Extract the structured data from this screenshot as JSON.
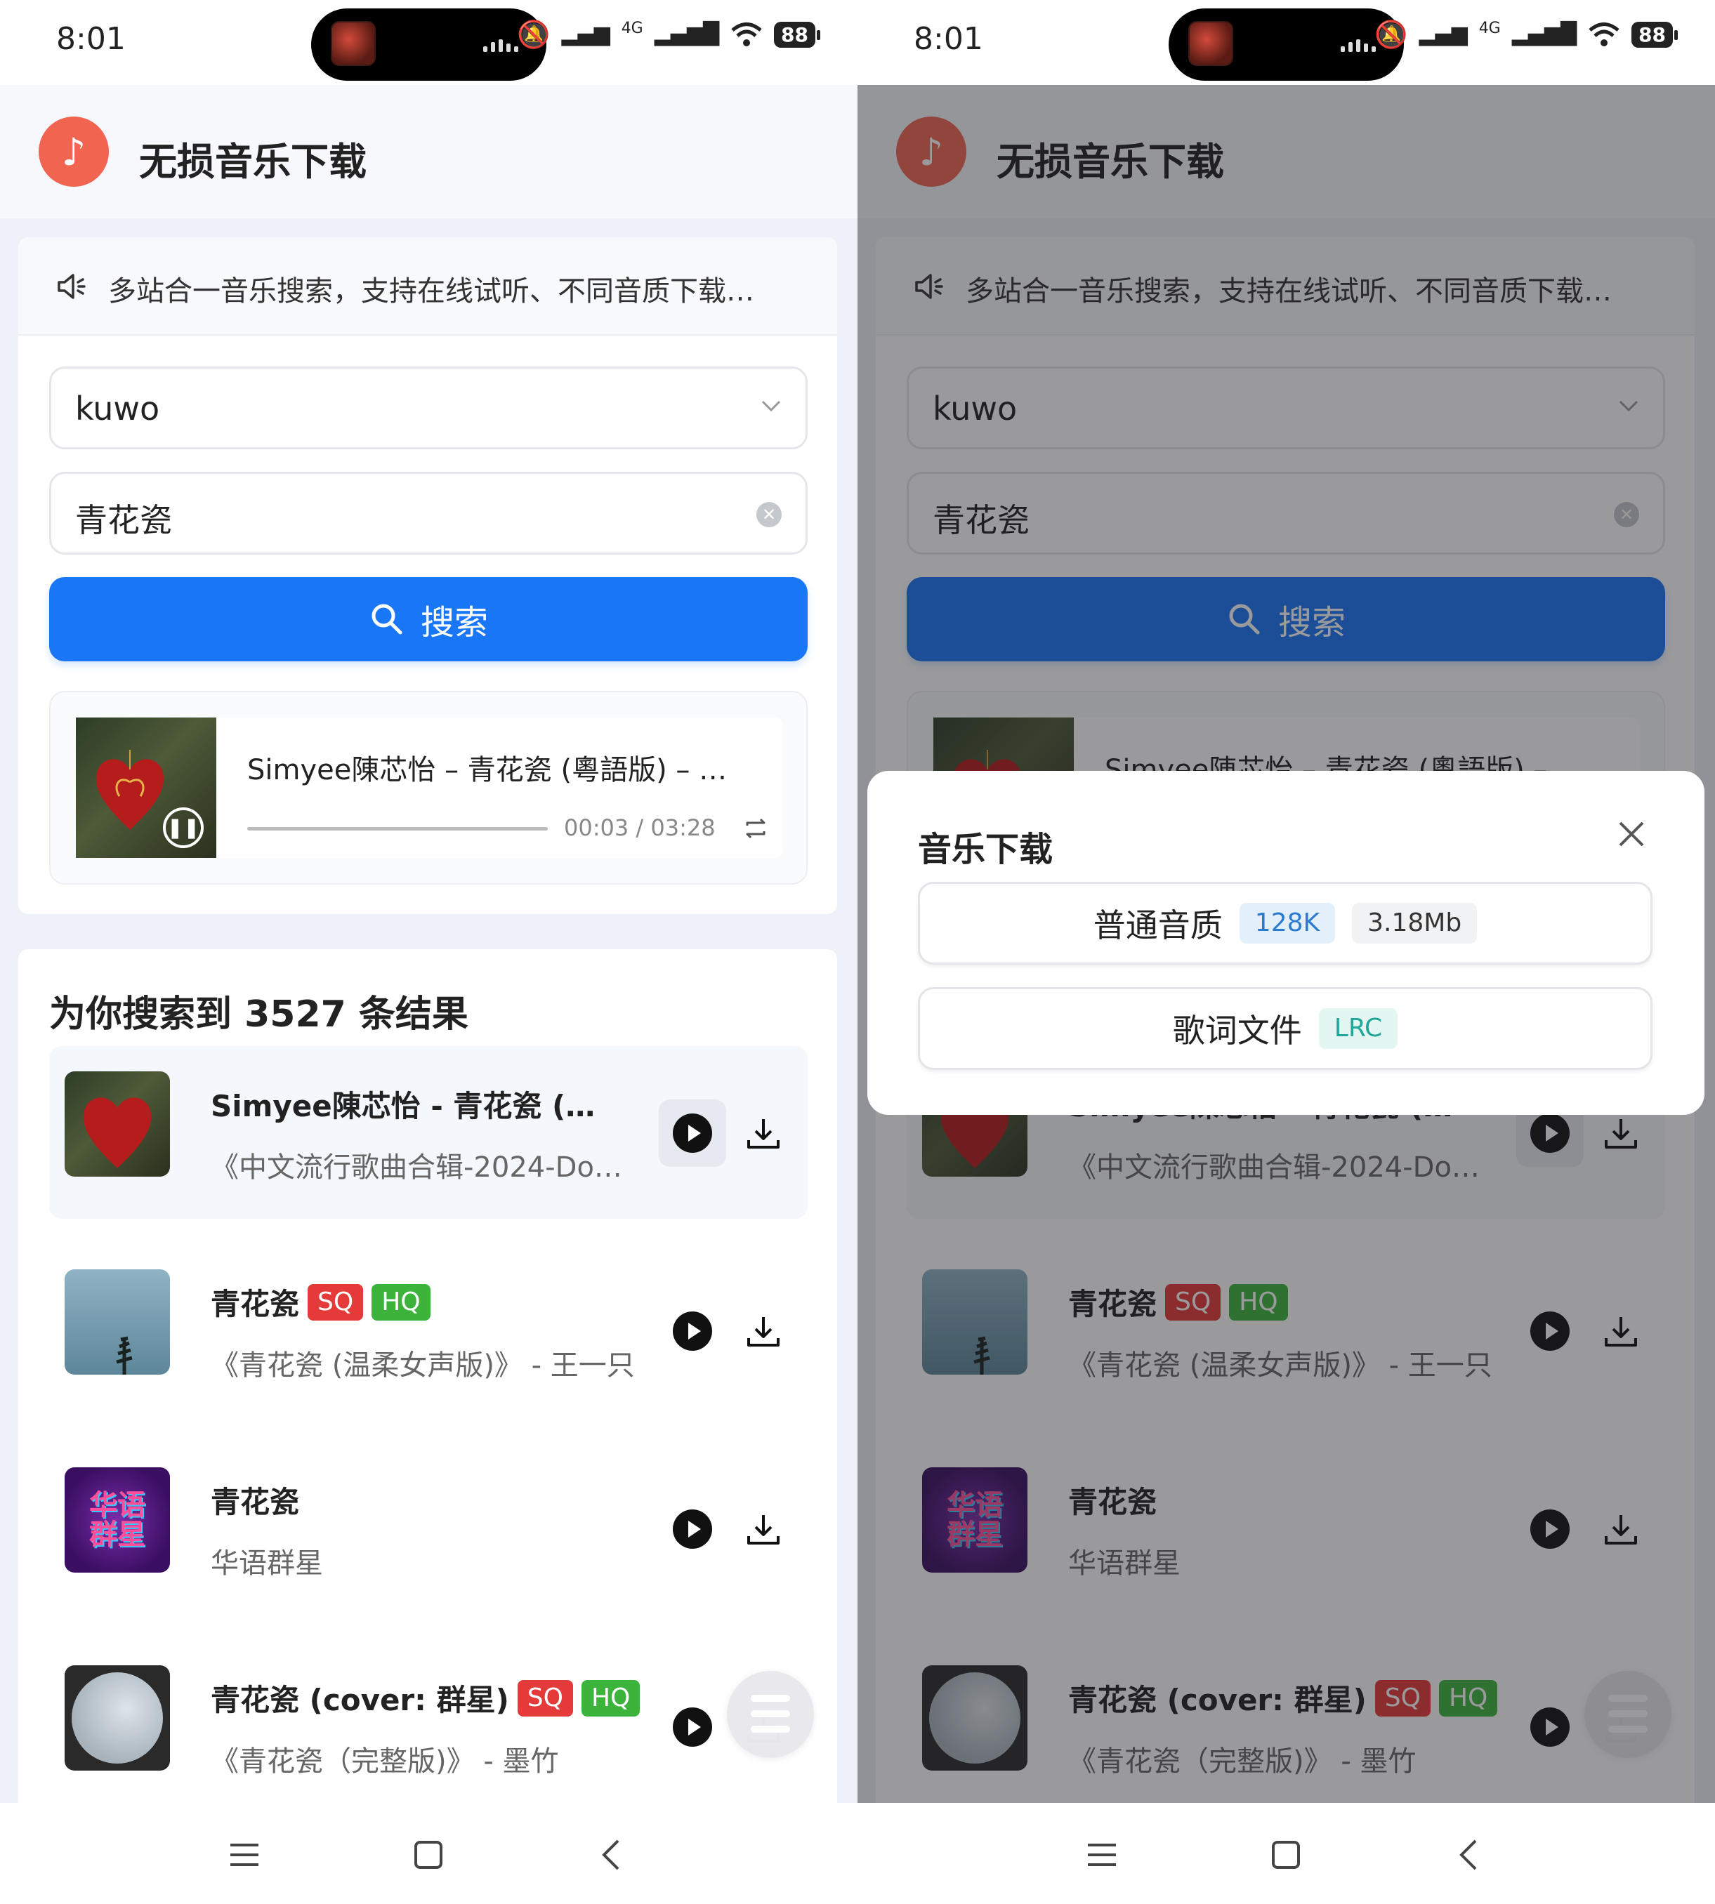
{
  "status": {
    "time": "8:01",
    "battery": "88",
    "network_label": "4G"
  },
  "app": {
    "title": "无损音乐下载"
  },
  "notice": {
    "text": "多站合一音乐搜索，支持在线试听、不同音质下载…"
  },
  "search": {
    "source_value": "kuwo",
    "keyword_value": "青花瓷",
    "button_label": "搜索"
  },
  "player": {
    "title": "Simyee陳芯怡 – 青花瓷 (粵語版) – …",
    "time": "00:03 / 03:28",
    "progress": 0.015
  },
  "results": {
    "title": "为你搜索到 3527 条结果",
    "items": [
      {
        "title": "Simyee陳芯怡 - 青花瓷 (粤…",
        "subtitle": "《中文流行歌曲合辑-2024-Do…",
        "sq": "",
        "hq": "",
        "active": true
      },
      {
        "title": "青花瓷",
        "subtitle": "《青花瓷 (温柔女声版)》 - 王一只",
        "sq": "SQ",
        "hq": "HQ",
        "active": false
      },
      {
        "title": "青花瓷",
        "subtitle": "华语群星",
        "sq": "",
        "hq": "",
        "active": false
      },
      {
        "title": "青花瓷 (cover: 群星)",
        "subtitle": "《青花瓷（完整版)》 - 墨竹",
        "sq": "SQ",
        "hq": "HQ",
        "active": false
      }
    ],
    "thumb3_text": "华语群星"
  },
  "dialog": {
    "title": "音乐下载",
    "option1_label": "普通音质",
    "option1_bitrate": "128K",
    "option1_size": "3.18Mb",
    "option2_label": "歌词文件",
    "option2_tag": "LRC"
  },
  "colors": {
    "primary": "#1976f6",
    "logo": "#f06450",
    "sq": "#e43a3a",
    "hq": "#3cb43c"
  }
}
